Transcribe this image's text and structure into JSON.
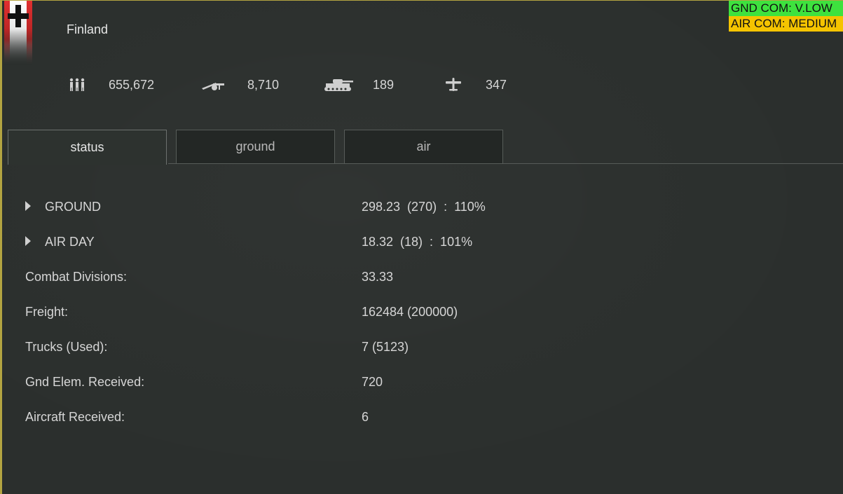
{
  "header": {
    "nation": "Finland",
    "gnd_com": "GND COM: V.LOW",
    "air_com": "AIR COM: MEDIUM",
    "colors": {
      "gnd_badge": "#3ee23e",
      "air_badge": "#f5c400"
    }
  },
  "stats": [
    {
      "icon": "infantry-icon",
      "value": "655,672"
    },
    {
      "icon": "artillery-icon",
      "value": "8,710"
    },
    {
      "icon": "tank-icon",
      "value": "189"
    },
    {
      "icon": "aircraft-icon",
      "value": "347"
    }
  ],
  "tabs": [
    {
      "label": "status",
      "active": true
    },
    {
      "label": "ground",
      "active": false
    },
    {
      "label": "air",
      "active": false
    }
  ],
  "status_rows": [
    {
      "label": "GROUND",
      "value": "298.23  (270)  :  110%",
      "expandable": true
    },
    {
      "label": "AIR DAY",
      "value": "18.32  (18)  :  101%",
      "expandable": true
    },
    {
      "label": "Combat Divisions:",
      "value": "33.33",
      "expandable": false
    },
    {
      "label": "Freight:",
      "value": "162484 (200000)",
      "expandable": false
    },
    {
      "label": "Trucks (Used):",
      "value": "7 (5123)",
      "expandable": false
    },
    {
      "label": "Gnd Elem. Received:",
      "value": "720",
      "expandable": false
    },
    {
      "label": "Aircraft Received:",
      "value": "6",
      "expandable": false
    }
  ]
}
